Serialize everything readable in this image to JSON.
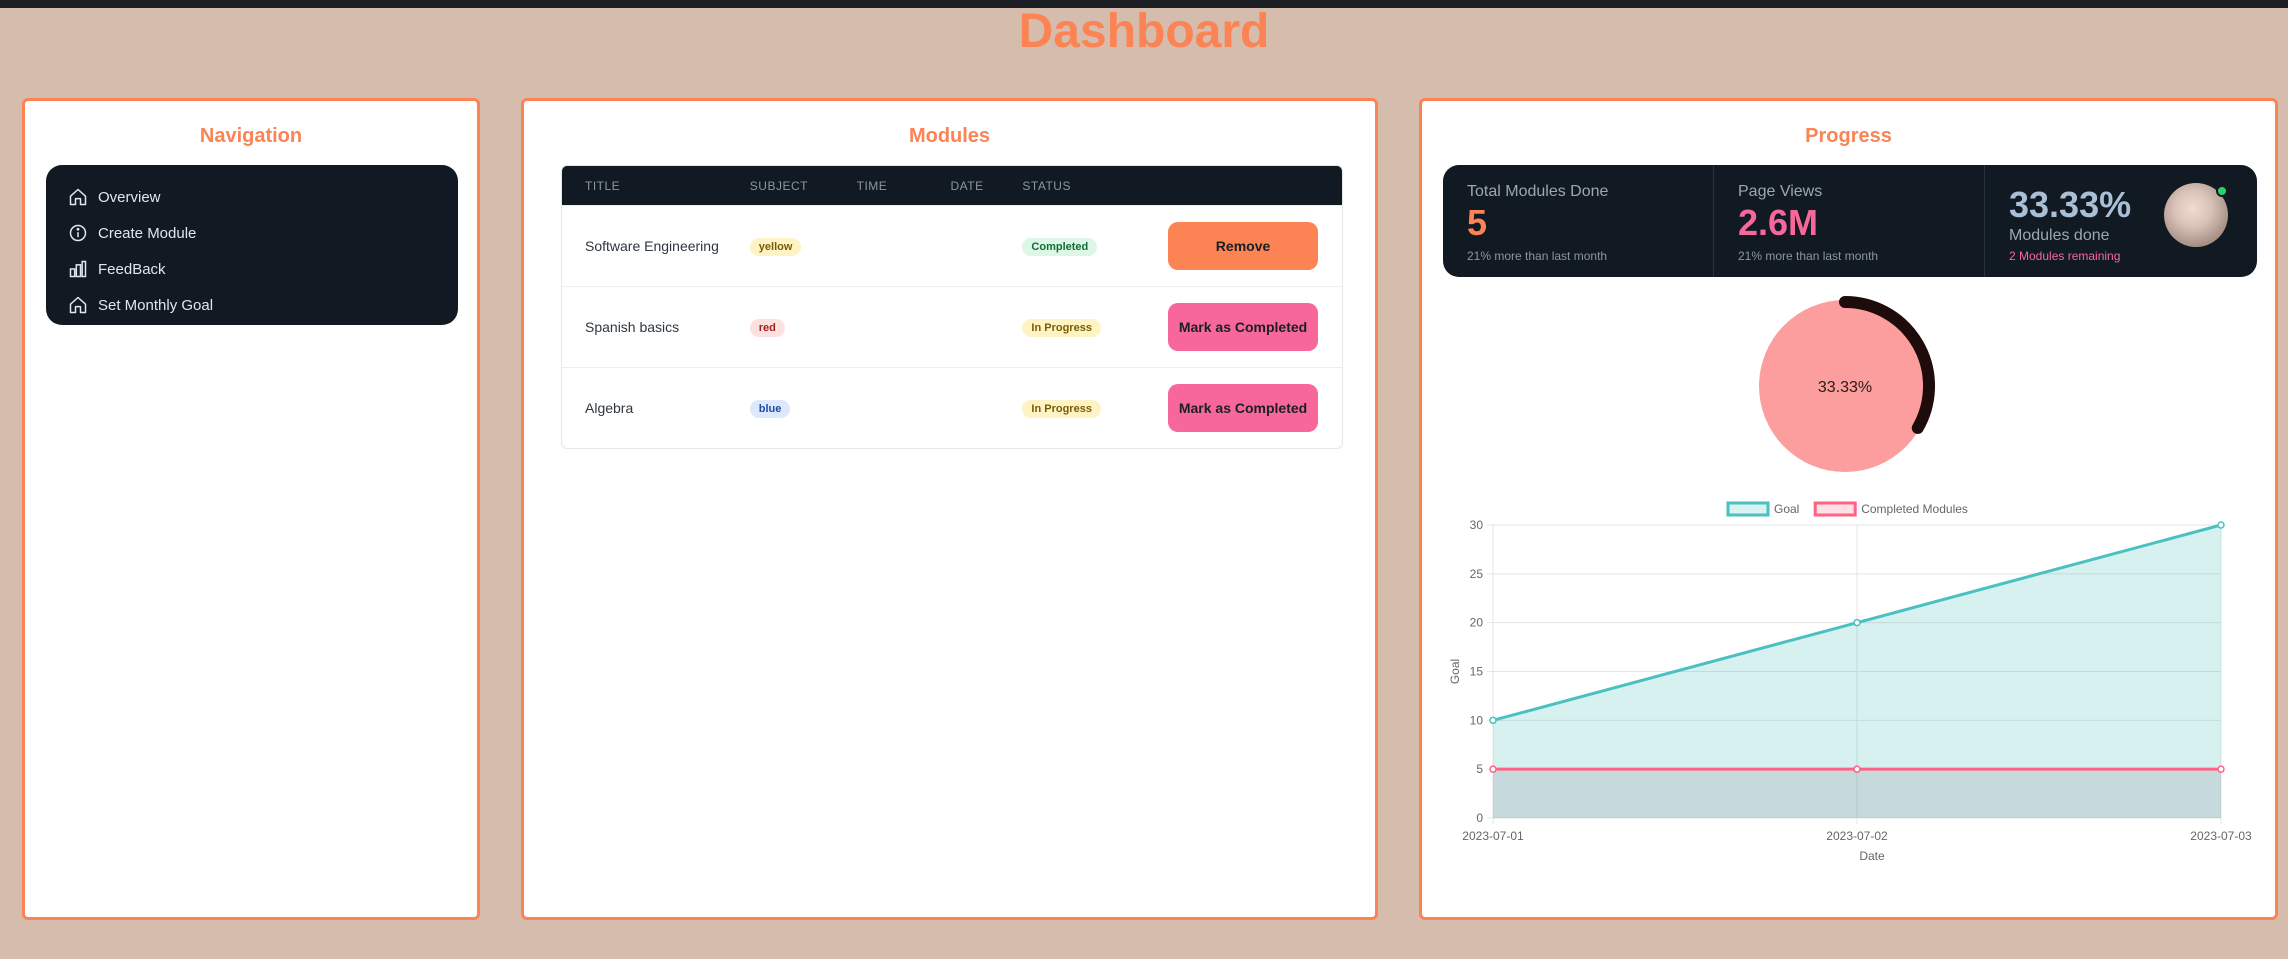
{
  "page": {
    "title": "Dashboard"
  },
  "navigation": {
    "title": "Navigation",
    "items": [
      {
        "label": "Overview",
        "icon": "home-icon"
      },
      {
        "label": "Create Module",
        "icon": "info-icon"
      },
      {
        "label": "FeedBack",
        "icon": "bar-chart-icon"
      },
      {
        "label": "Set Monthly Goal",
        "icon": "home-icon"
      }
    ]
  },
  "modules": {
    "title": "Modules",
    "columns": [
      "TITLE",
      "SUBJECT",
      "TIME",
      "DATE",
      "STATUS"
    ],
    "rows": [
      {
        "title": "Software Engineering",
        "subject": "yellow",
        "time": "",
        "date": "",
        "status": "Completed",
        "action": "Remove"
      },
      {
        "title": "Spanish basics",
        "subject": "red",
        "time": "",
        "date": "",
        "status": "In Progress",
        "action": "Mark as Completed"
      },
      {
        "title": "Algebra",
        "subject": "blue",
        "time": "",
        "date": "",
        "status": "In Progress",
        "action": "Mark as Completed"
      }
    ]
  },
  "progress": {
    "title": "Progress",
    "stats": [
      {
        "label": "Total Modules Done",
        "value": "5",
        "desc": "21% more than last month"
      },
      {
        "label": "Page Views",
        "value": "2.6M",
        "desc": "21% more than last month"
      },
      {
        "label": "Modules done",
        "value": "33.33%",
        "desc": "2 Modules remaining"
      }
    ],
    "donut": {
      "label": "33.33%",
      "fraction": 0.3333
    }
  },
  "colors": {
    "accent": "#fb8354",
    "pink": "#f7679a",
    "goal": "#4bc0c0",
    "completed": "#ff6384",
    "dark": "#111a22"
  },
  "chart_data": {
    "type": "line",
    "x": [
      "2023-07-01",
      "2023-07-02",
      "2023-07-03"
    ],
    "series": [
      {
        "name": "Goal",
        "values": [
          10,
          20,
          30
        ],
        "color": "#4bc0c0",
        "fill": true
      },
      {
        "name": "Completed Modules",
        "values": [
          5,
          5,
          5
        ],
        "color": "#ff6384",
        "fill": true
      }
    ],
    "xlabel": "Date",
    "ylabel": "Goal",
    "ylim": [
      0,
      30
    ],
    "yticks": [
      0,
      5,
      10,
      15,
      20,
      25,
      30
    ],
    "grid": true,
    "legend": "top"
  }
}
